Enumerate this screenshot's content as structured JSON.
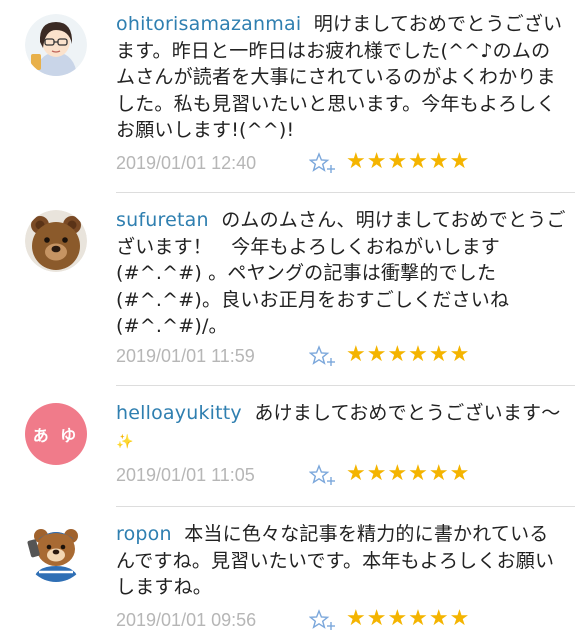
{
  "colors": {
    "username": "#2f7fb0",
    "timestamp": "#b6b6b6",
    "star": "#f4b400",
    "add_star": "#7ba7db",
    "avatar_pink": "#f07b8a"
  },
  "comments": [
    {
      "username": "ohitorisamazanmai",
      "body": "明けましておめでとうございます。昨日と一昨日はお疲れ様でした(^^♪のムのムさんが読者を大事にされているのがよくわかりました。私も見習いたいと思います。今年もよろしくお願いします!(^^)!",
      "timestamp": "2019/01/01 12:40",
      "stars": "★★★★★★",
      "star_count": 6,
      "avatar_icon": "illustrated-woman-avatar"
    },
    {
      "username": "sufuretan",
      "body": "のムのムさん、明けましておめでとうございます！　今年もよろしくおねがいします(#^.^#) 。ペヤングの記事は衝撃的でした(#^.^#)。良いお正月をおすごしくださいね(#^.^#)/。",
      "timestamp": "2019/01/01 11:59",
      "stars": "★★★★★★",
      "star_count": 6,
      "avatar_icon": "teddy-bear-avatar"
    },
    {
      "username": "helloayukitty",
      "body": "あけましておめでとうございます〜",
      "timestamp": "2019/01/01 11:05",
      "stars": "★★★★★★",
      "star_count": 6,
      "avatar_text": "あ ゆ",
      "avatar_icon": "text-avatar"
    },
    {
      "username": "ropon",
      "body": "本当に色々な記事を精力的に書かれているんですね。見習いたいです。本年もよろしくお願いしますね。",
      "timestamp": "2019/01/01 09:56",
      "stars": "★★★★★★",
      "star_count": 6,
      "avatar_icon": "cartoon-bear-avatar"
    }
  ]
}
